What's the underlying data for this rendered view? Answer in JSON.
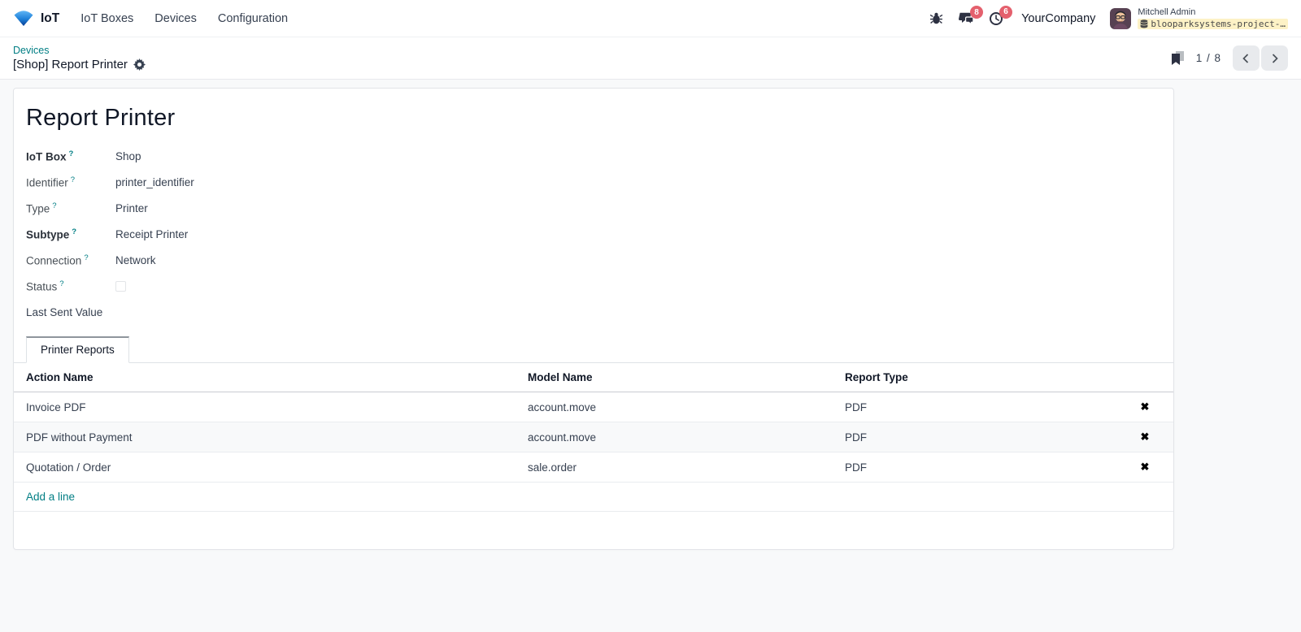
{
  "navbar": {
    "app_name": "IoT",
    "menus": [
      "IoT Boxes",
      "Devices",
      "Configuration"
    ],
    "messages_badge": "8",
    "activities_badge": "6",
    "company": "YourCompany",
    "user_name": "Mitchell Admin",
    "database": "blooparksystems-project-…"
  },
  "breadcrumb": {
    "parent": "Devices",
    "current": "[Shop] Report Printer"
  },
  "pager": {
    "value": "1 / 8"
  },
  "form": {
    "title": "Report Printer",
    "help_glyph": "?",
    "fields": [
      {
        "label": "IoT Box",
        "value": "Shop",
        "required": true
      },
      {
        "label": "Identifier",
        "value": "printer_identifier",
        "required": false
      },
      {
        "label": "Type",
        "value": "Printer",
        "required": false
      },
      {
        "label": "Subtype",
        "value": "Receipt Printer",
        "required": true
      },
      {
        "label": "Connection",
        "value": "Network",
        "required": false
      },
      {
        "label": "Status",
        "value": "",
        "required": false,
        "checkbox": true
      },
      {
        "label": "Last Sent Value",
        "value": "",
        "required": false
      }
    ],
    "tab": "Printer Reports",
    "table": {
      "headers": [
        "Action Name",
        "Model Name",
        "Report Type"
      ],
      "rows": [
        {
          "action": "Invoice PDF",
          "model": "account.move",
          "type": "PDF"
        },
        {
          "action": "PDF without Payment",
          "model": "account.move",
          "type": "PDF"
        },
        {
          "action": "Quotation / Order",
          "model": "sale.order",
          "type": "PDF"
        }
      ],
      "delete_glyph": "✖",
      "add_line": "Add a line"
    }
  },
  "icons": {
    "app_logo": "wifi-fan",
    "bug": "bug",
    "messages": "chat-bubbles",
    "activities": "clock",
    "database": "db-cylinder",
    "settings_gear": "gear",
    "bookmark": "bookmark",
    "pager_previous": "chevron-left",
    "pager_next": "chevron-right",
    "delete_row": "x-mark"
  },
  "colors": {
    "accent": "#017e84",
    "badge": "#e4606d",
    "db_highlight": "#fdf2c6"
  }
}
